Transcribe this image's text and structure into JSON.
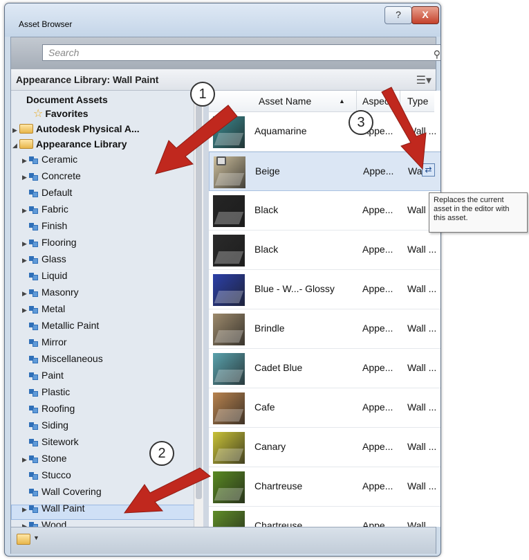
{
  "window": {
    "title": "Asset Browser",
    "help_glyph": "?",
    "close_glyph": "X"
  },
  "search": {
    "placeholder": "Search"
  },
  "library_header": {
    "title": "Appearance Library: Wall Paint"
  },
  "tree": {
    "document_assets": "Document Assets",
    "favorites": "Favorites",
    "autodesk_physical": "Autodesk Physical A...",
    "appearance_library": "Appearance Library",
    "items": [
      {
        "label": "Ceramic",
        "expandable": true
      },
      {
        "label": "Concrete",
        "expandable": true
      },
      {
        "label": "Default",
        "expandable": false
      },
      {
        "label": "Fabric",
        "expandable": true
      },
      {
        "label": "Finish",
        "expandable": false
      },
      {
        "label": "Flooring",
        "expandable": true
      },
      {
        "label": "Glass",
        "expandable": true
      },
      {
        "label": "Liquid",
        "expandable": false
      },
      {
        "label": "Masonry",
        "expandable": true
      },
      {
        "label": "Metal",
        "expandable": true
      },
      {
        "label": "Metallic Paint",
        "expandable": false
      },
      {
        "label": "Mirror",
        "expandable": false
      },
      {
        "label": "Miscellaneous",
        "expandable": false
      },
      {
        "label": "Paint",
        "expandable": false
      },
      {
        "label": "Plastic",
        "expandable": false
      },
      {
        "label": "Roofing",
        "expandable": false
      },
      {
        "label": "Siding",
        "expandable": false
      },
      {
        "label": "Sitework",
        "expandable": false
      },
      {
        "label": "Stone",
        "expandable": true
      },
      {
        "label": "Stucco",
        "expandable": false
      },
      {
        "label": "Wall Covering",
        "expandable": false
      },
      {
        "label": "Wall Paint",
        "expandable": true
      },
      {
        "label": "Wood",
        "expandable": true
      }
    ],
    "selected": "Wall Paint"
  },
  "grid": {
    "columns": [
      "Asset Name",
      "Aspect",
      "Type"
    ],
    "rows": [
      {
        "name": "Aquamarine",
        "aspect": "Appe...",
        "type": "Wall ...",
        "color": "#3d8e93",
        "locked": false
      },
      {
        "name": "Beige",
        "aspect": "Appe...",
        "type": "Wa",
        "color": "#cdbf9d",
        "locked": true,
        "selected": true
      },
      {
        "name": "Black",
        "aspect": "Appe...",
        "type": "Wall",
        "color": "#252525",
        "locked": false
      },
      {
        "name": "Black",
        "aspect": "Appe...",
        "type": "Wall ...",
        "color": "#2a2a2a",
        "locked": false
      },
      {
        "name": "Blue - W...- Glossy",
        "aspect": "Appe...",
        "type": "Wall ...",
        "color": "#2c40a8",
        "locked": false
      },
      {
        "name": "Brindle",
        "aspect": "Appe...",
        "type": "Wall ...",
        "color": "#9d8a6c",
        "locked": false
      },
      {
        "name": "Cadet Blue",
        "aspect": "Appe...",
        "type": "Wall ...",
        "color": "#5aa2ad",
        "locked": false
      },
      {
        "name": "Cafe",
        "aspect": "Appe...",
        "type": "Wall ...",
        "color": "#b8834f",
        "locked": false
      },
      {
        "name": "Canary",
        "aspect": "Appe...",
        "type": "Wall ...",
        "color": "#c9c238",
        "locked": false
      },
      {
        "name": "Chartreuse",
        "aspect": "Appe...",
        "type": "Wall ...",
        "color": "#5a8a23",
        "locked": false
      },
      {
        "name": "Chartreuse",
        "aspect": "Appe...",
        "type": "Wall ...",
        "color": "#5f8d28",
        "locked": false
      }
    ]
  },
  "tooltip": {
    "text": "Replaces the current asset in the editor with this asset."
  },
  "callouts": [
    "1",
    "2",
    "3"
  ],
  "colors": {
    "arrow": "#c0281e",
    "selection": "#cfe0f6"
  }
}
